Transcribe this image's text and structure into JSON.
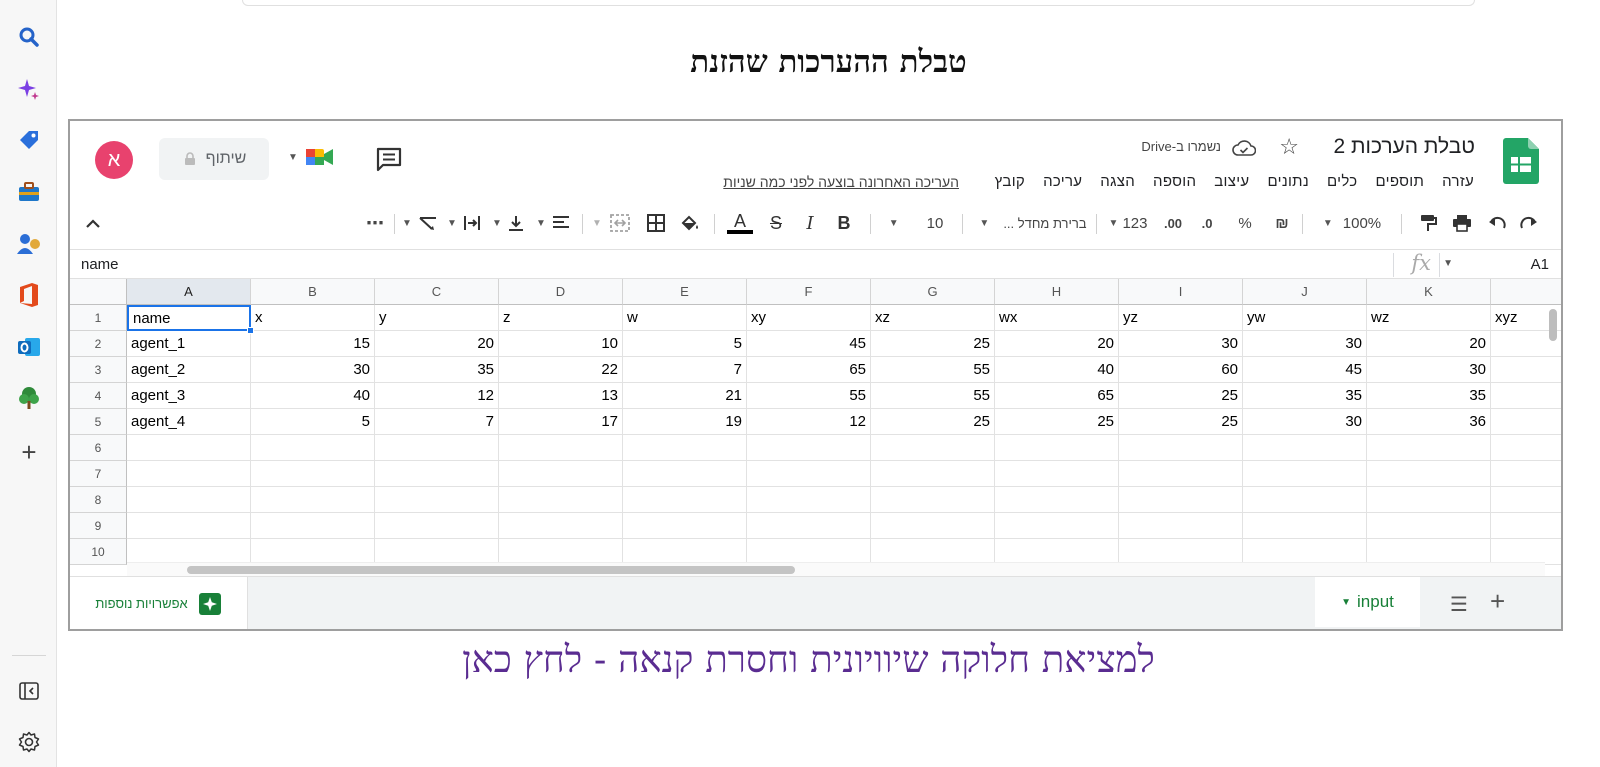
{
  "page": {
    "heading": "טבלת ההערכות שהזנת",
    "link_text": "למציאת חלוקה שיוויונית וחסרת קנאה - לחץ כאן"
  },
  "browser_sidebar": {
    "icons": [
      "search-icon",
      "copilot-icon",
      "shopping-tag-icon",
      "toolbox-icon",
      "people-icon",
      "office-icon",
      "outlook-icon",
      "tree-icon",
      "add-icon",
      "sidebar-toggle-icon",
      "settings-icon"
    ]
  },
  "sheets": {
    "title": "טבלת הערכות 2",
    "saved_status": "נשמרו ב-Drive",
    "menu": [
      "קובץ",
      "עריכה",
      "הצגה",
      "הוספה",
      "עיצוב",
      "נתונים",
      "כלים",
      "תוספים",
      "עזרה"
    ],
    "last_edit": "העריכה האחרונה בוצעה לפני כמה שניות",
    "share_label": "שיתוף",
    "avatar_letter": "א",
    "toolbar": {
      "zoom": "100%",
      "currency": "₪",
      "percent": "%",
      "dec_decrease": ".0",
      "dec_increase": ".00",
      "number_format": "123",
      "font": "ברירת מחדל ...",
      "font_size": "10",
      "bold": "B",
      "italic": "I",
      "strike": "S",
      "text_color": "A",
      "more": "⋯"
    },
    "name_box": "A1",
    "formula_content": "name",
    "columns": [
      "A",
      "B",
      "C",
      "D",
      "E",
      "F",
      "G",
      "H",
      "I",
      "J",
      "K"
    ],
    "row_numbers": [
      "1",
      "2",
      "3",
      "4",
      "5",
      "6",
      "7",
      "8",
      "9",
      "10"
    ],
    "rows": [
      [
        "name",
        "x",
        "y",
        "z",
        "w",
        "xy",
        "xz",
        "wx",
        "yz",
        "yw",
        "wz",
        "xyz"
      ],
      [
        "agent_1",
        "15",
        "20",
        "10",
        "5",
        "45",
        "25",
        "20",
        "30",
        "30",
        "20",
        ""
      ],
      [
        "agent_2",
        "30",
        "35",
        "22",
        "7",
        "65",
        "55",
        "40",
        "60",
        "45",
        "30",
        ""
      ],
      [
        "agent_3",
        "40",
        "12",
        "13",
        "21",
        "55",
        "55",
        "65",
        "25",
        "35",
        "35",
        ""
      ],
      [
        "agent_4",
        "5",
        "7",
        "17",
        "19",
        "12",
        "25",
        "25",
        "25",
        "30",
        "36",
        ""
      ]
    ],
    "sheet_tab": "input",
    "explore_label": "אפשרויות נוספות",
    "colors": {
      "accent": "#188038",
      "selection": "#1a73e8",
      "avatar": "#e8426e",
      "link": "#5a2c91"
    }
  }
}
